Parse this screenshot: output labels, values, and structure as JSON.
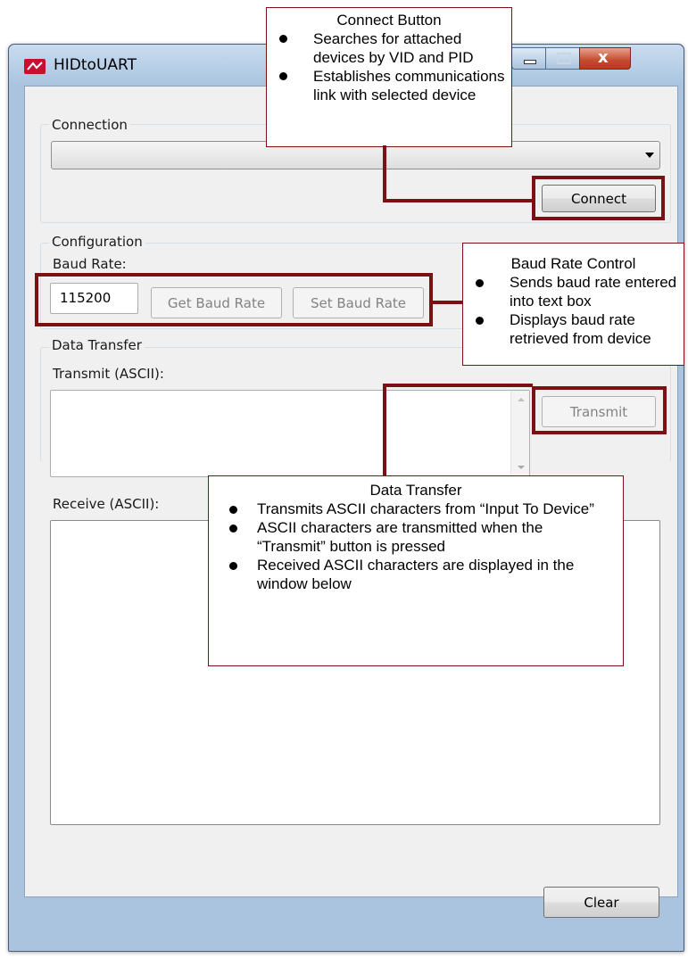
{
  "window": {
    "title": "HIDtoUART"
  },
  "connection": {
    "group_label": "Connection",
    "device_selected": "",
    "connect_label": "Connect"
  },
  "configuration": {
    "group_label": "Configuration",
    "baud_label": "Baud Rate:",
    "baud_value": "115200",
    "get_label": "Get Baud Rate",
    "set_label": "Set Baud Rate"
  },
  "data_transfer": {
    "group_label": "Data Transfer",
    "transmit_label": "Transmit (ASCII):",
    "transmit_text": "",
    "transmit_button": "Transmit",
    "receive_label": "Receive (ASCII):",
    "receive_text": "",
    "clear_label": "Clear"
  },
  "annotations": {
    "connect": {
      "title": "Connect Button",
      "bullets": [
        "Searches for attached devices by VID and PID",
        "Establishes communications link with selected device"
      ]
    },
    "baud": {
      "title": "Baud Rate Control",
      "bullets": [
        "Sends baud rate entered into text box",
        "Displays baud rate retrieved from device"
      ]
    },
    "data": {
      "title": "Data Transfer",
      "bullets": [
        "Transmits ASCII characters from “Input To Device”",
        "ASCII characters are transmitted when the “Transmit” button is pressed",
        "Received ASCII characters are displayed in the window below"
      ]
    }
  },
  "colors": {
    "annotation": "#7b1113",
    "titlebar": "#aac3de",
    "client": "#f0f0f0"
  }
}
